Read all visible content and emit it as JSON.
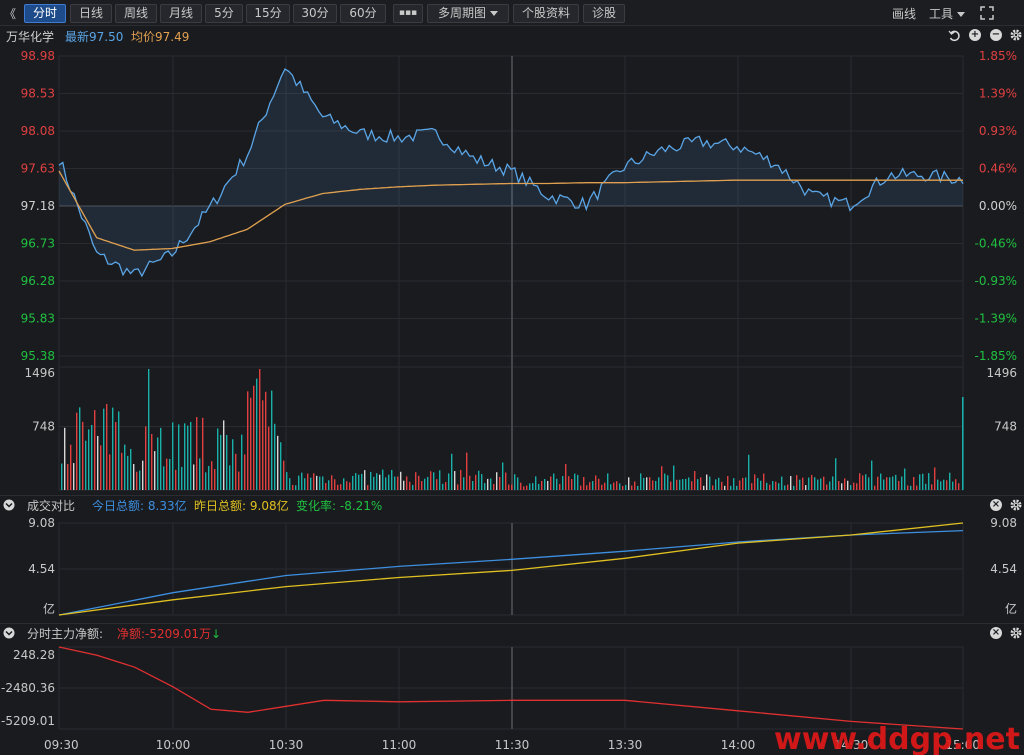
{
  "toolbar": {
    "back": "《",
    "tabs": [
      "分时",
      "日线",
      "周线",
      "月线",
      "5分",
      "15分",
      "30分",
      "60分",
      "▪▪▪",
      "多周期图",
      "个股资料",
      "诊股"
    ],
    "draw": "画线",
    "tools": "工具"
  },
  "info": {
    "name": "万华化学",
    "latest_label": "最新",
    "latest": "97.50",
    "avg_label": "均价",
    "avg": "97.49"
  },
  "price_axis_left": [
    "98.98",
    "98.53",
    "98.08",
    "97.63",
    "97.18",
    "96.73",
    "96.28",
    "95.83",
    "95.38"
  ],
  "price_axis_right": [
    "1.85%",
    "1.39%",
    "0.93%",
    "0.46%",
    "0.00%",
    "-0.46%",
    "-0.93%",
    "-1.39%",
    "-1.85%"
  ],
  "volume_axis": [
    "1496",
    "748"
  ],
  "turnover": {
    "title": "成交对比",
    "today_label": "今日总额:",
    "today": "8.33亿",
    "yest_label": "昨日总额:",
    "yest": "9.08亿",
    "change_label": "变化率:",
    "change": "-8.21%",
    "axis": [
      "9.08",
      "4.54",
      "亿"
    ]
  },
  "netflow": {
    "title": "分时主力净额:",
    "net_label": "净额:",
    "net": "-5209.01万",
    "axis": [
      "248.28",
      "-2480.36",
      "-5209.01"
    ]
  },
  "time_axis": [
    "09:30",
    "10:00",
    "10:30",
    "11:00",
    "11:30",
    "13:30",
    "14:00",
    "14:30",
    "15:00"
  ],
  "watermark": "www.ddgp.net",
  "colors": {
    "price_line": "#5aa5e6",
    "avg_line": "#e0a050",
    "up": "#e04040",
    "down": "#18b0a8",
    "today_line": "#3d8fe0",
    "yest_line": "#e0c020",
    "net_line": "#e03030"
  },
  "chart_data": [
    {
      "type": "line",
      "title": "",
      "x": [
        "09:30",
        "09:40",
        "09:50",
        "10:00",
        "10:10",
        "10:20",
        "10:30",
        "10:40",
        "10:50",
        "11:00",
        "11:10",
        "11:20",
        "11:30",
        "13:10",
        "13:20",
        "13:30",
        "13:40",
        "13:50",
        "14:00",
        "14:10",
        "14:20",
        "14:30",
        "14:40",
        "14:50",
        "15:00"
      ],
      "series": [
        {
          "name": "最新",
          "values": [
            97.75,
            96.6,
            96.35,
            96.6,
            97.15,
            97.8,
            98.85,
            98.25,
            98.05,
            98.0,
            98.05,
            97.75,
            97.6,
            97.3,
            97.2,
            97.65,
            97.85,
            97.95,
            97.9,
            97.7,
            97.3,
            97.2,
            97.55,
            97.55,
            97.5
          ]
        },
        {
          "name": "均价",
          "values": [
            97.6,
            96.8,
            96.65,
            96.67,
            96.75,
            96.9,
            97.2,
            97.33,
            97.38,
            97.41,
            97.43,
            97.44,
            97.45,
            97.45,
            97.46,
            97.46,
            97.47,
            97.48,
            97.49,
            97.49,
            97.49,
            97.49,
            97.49,
            97.49,
            97.49
          ]
        }
      ],
      "ylim": [
        95.38,
        98.98
      ]
    },
    {
      "type": "bar",
      "title": "",
      "ylim": [
        0,
        1496
      ]
    },
    {
      "type": "line",
      "title": "成交对比",
      "x": [
        "09:30",
        "10:00",
        "10:30",
        "11:00",
        "11:30",
        "13:30",
        "14:00",
        "14:30",
        "15:00"
      ],
      "series": [
        {
          "name": "今日总额",
          "values": [
            0,
            2.2,
            3.9,
            4.8,
            5.5,
            6.3,
            7.2,
            7.9,
            8.33
          ]
        },
        {
          "name": "昨日总额",
          "values": [
            0,
            1.5,
            2.8,
            3.7,
            4.4,
            5.6,
            7.1,
            7.9,
            9.08
          ]
        }
      ],
      "ylim": [
        0,
        9.08
      ]
    },
    {
      "type": "line",
      "title": "分时主力净额",
      "x": [
        "09:30",
        "09:40",
        "09:50",
        "10:00",
        "10:10",
        "10:20",
        "10:30",
        "10:40",
        "11:00",
        "11:30",
        "13:30",
        "14:00",
        "14:30",
        "15:00"
      ],
      "series": [
        {
          "name": "净额",
          "values": [
            248.28,
            -300,
            -1100,
            -2400,
            -3900,
            -4100,
            -3700,
            -3300,
            -3400,
            -3300,
            -3300,
            -4000,
            -4700,
            -5209.01
          ]
        }
      ],
      "ylim": [
        -5209.01,
        248.28
      ]
    }
  ]
}
